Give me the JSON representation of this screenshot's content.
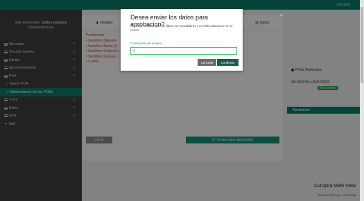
{
  "header": {
    "brand": "Curupira"
  },
  "sidebar": {
    "welcome_line1": "Seja bienvenido:",
    "welcome_name": "Carlos Gustavo",
    "welcome_line2": "cbuenopermisoo",
    "items": [
      {
        "label": "Mis datos",
        "chevron": "«",
        "icon": "hamburger-icon"
      },
      {
        "label": "Vincular regente",
        "chevron": "«",
        "icon": "hamburger-icon"
      },
      {
        "label": "Equipo",
        "chevron": "«",
        "icon": "hamburger-icon"
      },
      {
        "label": "Aprovechamiento",
        "chevron": "«",
        "icon": "hamburger-icon"
      },
      {
        "label": "POA",
        "chevron": "»",
        "icon": "hamburger-icon"
      },
      {
        "label": "Nuevo POA",
        "chevron": "",
        "icon": "circle-icon"
      },
      {
        "label": "Administración de los POAs",
        "chevron": "",
        "icon": "circle-icon"
      },
      {
        "label": "Corta",
        "chevron": "«",
        "icon": "hamburger-icon"
      },
      {
        "label": "Raleo",
        "chevron": "«",
        "icon": "hamburger-icon"
      },
      {
        "label": "Guia",
        "chevron": "«",
        "icon": "hamburger-icon"
      },
      {
        "label": "Salir",
        "chevron": "",
        "icon": "logout-icon"
      }
    ]
  },
  "panel": {
    "tab_left": "Detalles",
    "tab_right": "Datos",
    "pendencias_title": "Pendencias",
    "pendencias": [
      "Semillero Balsamo",
      "Semillero Berba (E",
      "Semillero Cedro (Le",
      "Semillero Espavé (",
      "a armo"
    ],
    "btn_cerrar": "Cerrar",
    "btn_enviar": "Enviar para aprobacion"
  },
  "right": {
    "estado": "POAs finalizados",
    "fechas": "05/10/2018 a 05/07/2022",
    "badge": "En camino",
    "aprobacion": "Aprobacion"
  },
  "footer": {
    "title": "Curupira Web View",
    "subtitle": "Desarrollado por AnimaTag"
  },
  "modal": {
    "title": "Desea enviar los datos para aprobacion?",
    "close": "×",
    "description": "Al enviar certifico que los datos son verdaderos y no hubo alteracion en el censo",
    "field_label": "Contraseña de usuario",
    "field_value": "~|",
    "cancel": "Cancelar",
    "confirm": "Confirmar"
  },
  "colors": {
    "accent": "#0f7a68",
    "confirm": "#1a5c4e",
    "pending": "#c0392b"
  }
}
